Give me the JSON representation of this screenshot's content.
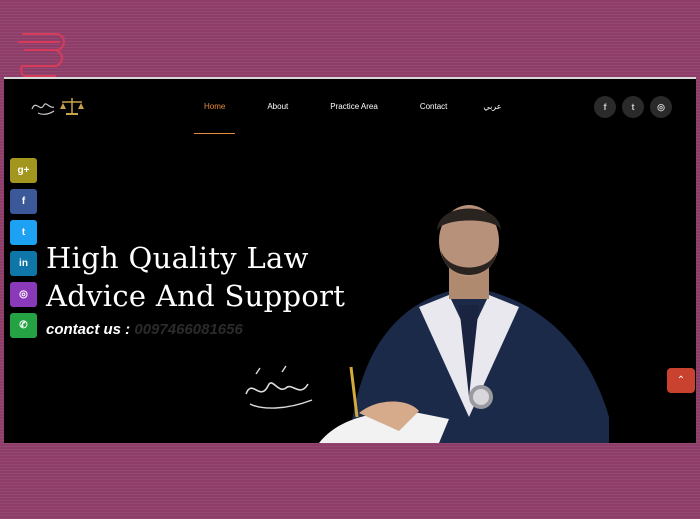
{
  "nav": {
    "items": [
      {
        "label": "Home",
        "active": true
      },
      {
        "label": "About"
      },
      {
        "label": "Practice Area"
      },
      {
        "label": "Contact"
      },
      {
        "label": "عربي"
      }
    ]
  },
  "social_top": {
    "icons": [
      "f",
      "t",
      "◎"
    ]
  },
  "hero": {
    "title_line1": "High Quality Law",
    "title_line2": "Advice And Support",
    "contact_label": "contact us : ",
    "phone": "0097466081656"
  },
  "side_social": {
    "items": [
      {
        "glyph": "g+",
        "color": "#a3961e"
      },
      {
        "glyph": "f",
        "color": "#3b5998"
      },
      {
        "glyph": "t",
        "color": "#1da1f2"
      },
      {
        "glyph": "in",
        "color": "#0e76a8"
      },
      {
        "glyph": "◎",
        "color": "#8a3ab9"
      },
      {
        "glyph": "✆",
        "color": "#25a244"
      }
    ]
  },
  "scroll_top": {
    "glyph": "⌃"
  },
  "colors": {
    "accent": "#e58a3a",
    "scroll_top": "#c9412f",
    "backdrop": "#8e3d68"
  }
}
